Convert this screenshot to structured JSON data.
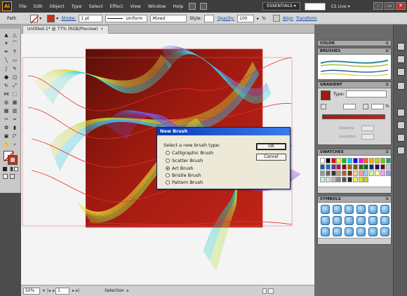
{
  "app": {
    "logo": "Ai"
  },
  "menubar": {
    "items": [
      "File",
      "Edit",
      "Object",
      "Type",
      "Select",
      "Effect",
      "View",
      "Window",
      "Help"
    ],
    "workspace": "ESSENTIALS ▾",
    "cs_live": "CS Live ▾",
    "window_controls": [
      "–",
      "▭",
      "✕"
    ]
  },
  "controlbar": {
    "selection_label": "Path",
    "stroke_label": "Stroke:",
    "stroke_value": "1 pt",
    "profile_value": "Uniform",
    "brush_value": "Mixed",
    "style_label": "Style:",
    "opacity_label": "Opacity:",
    "opacity_value": "100",
    "opacity_unit": "%",
    "align_label": "Align",
    "transform_label": "Transform"
  },
  "document": {
    "tab_title": "Untitled-1* @ 77% (RGB/Preview)",
    "tab_close": "×"
  },
  "statusbar": {
    "zoom": "50%",
    "page": "1",
    "tool": "Selection"
  },
  "panels": {
    "color": {
      "title": "COLOR"
    },
    "brushes": {
      "title": "BRUSHES"
    },
    "gradient": {
      "title": "GRADIENT",
      "type_label": "Type:",
      "percent_suffix": "%",
      "opacity_label": "Opacity:",
      "location_label": "Location:"
    },
    "swatches": {
      "title": "SWATCHES"
    },
    "symbols": {
      "title": "SYMBOLS"
    }
  },
  "dialog": {
    "title": "New Brush",
    "prompt": "Select a new brush type:",
    "options": [
      {
        "label": "Calligraphic Brush",
        "selected": false
      },
      {
        "label": "Scatter Brush",
        "selected": false
      },
      {
        "label": "Art Brush",
        "selected": true
      },
      {
        "label": "Bristle Brush",
        "selected": false
      },
      {
        "label": "Pattern Brush",
        "selected": false
      }
    ],
    "ok_label": "OK",
    "cancel_label": "Cancel"
  },
  "colors": {
    "ui_dark": "#3d3d3d",
    "accent_orange": "#f7a21b",
    "art_red": "#b01a10",
    "dialog_title_blue": "#0a3cb7"
  }
}
